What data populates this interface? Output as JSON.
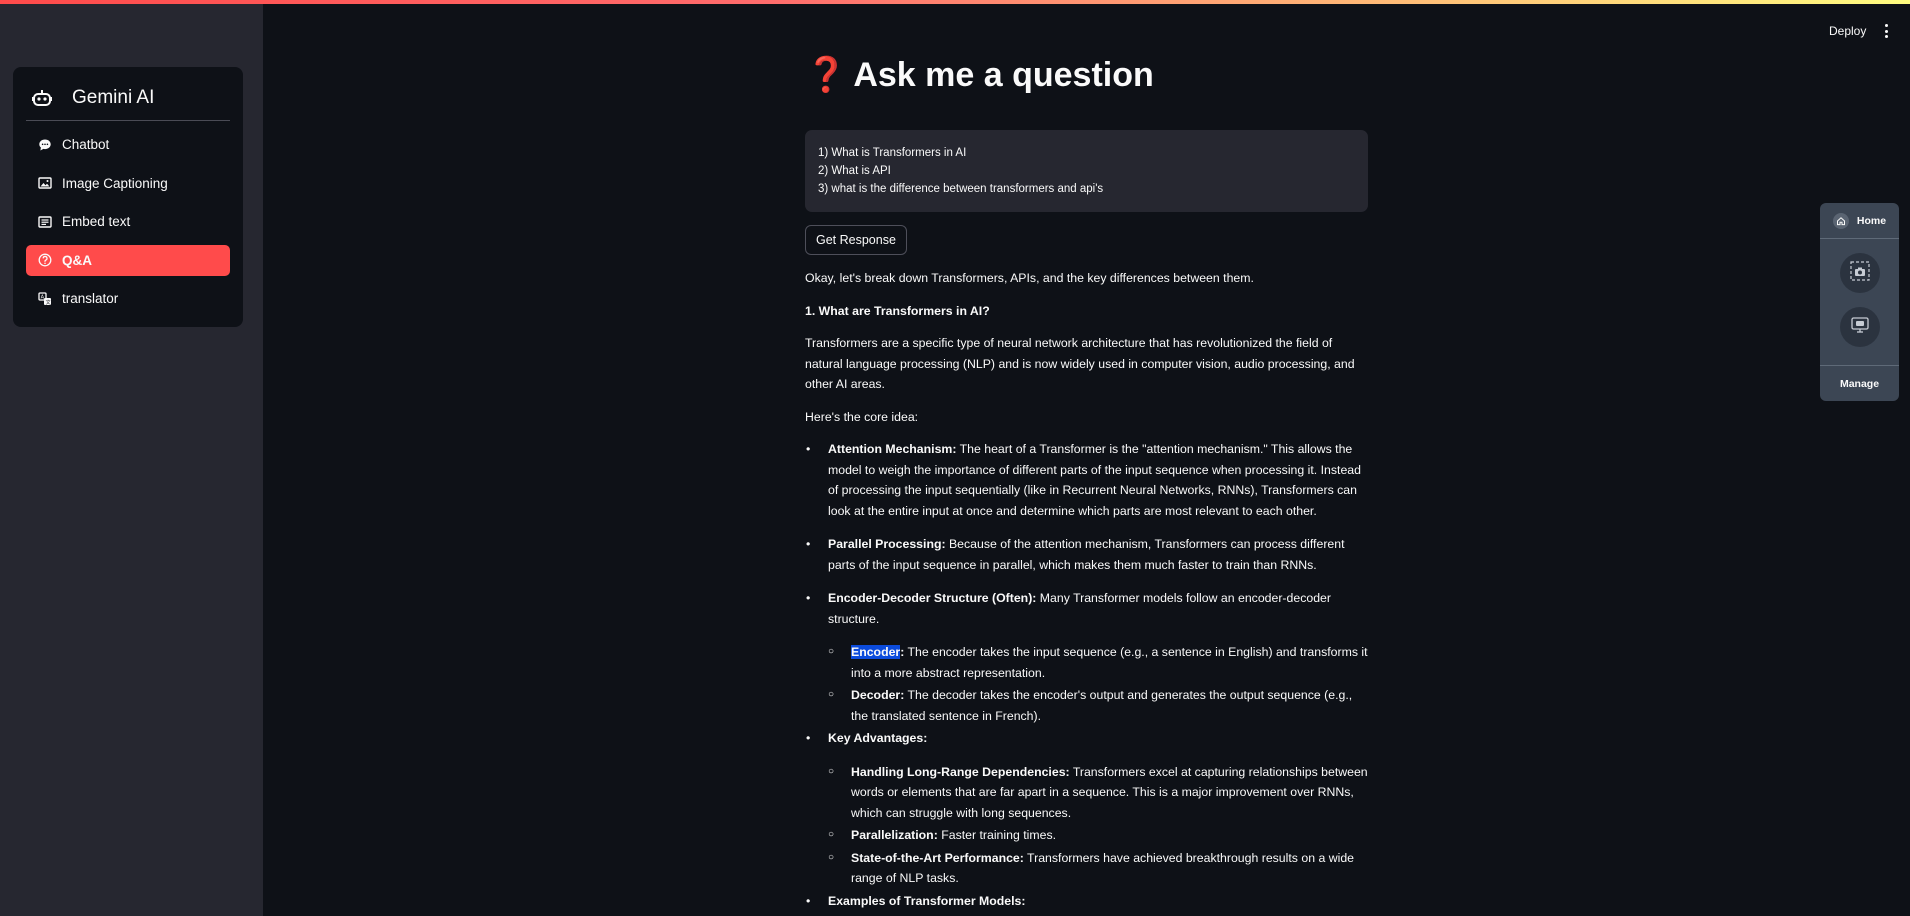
{
  "app": {
    "title": "Gemini AI"
  },
  "header": {
    "deploy_label": "Deploy"
  },
  "sidebar": {
    "items": [
      {
        "label": "Chatbot",
        "icon": "chat-bubble-icon",
        "active": false
      },
      {
        "label": "Image Captioning",
        "icon": "image-icon",
        "active": false
      },
      {
        "label": "Embed text",
        "icon": "text-card-icon",
        "active": false
      },
      {
        "label": "Q&A",
        "icon": "question-circle-icon",
        "active": true
      },
      {
        "label": "translator",
        "icon": "translate-icon",
        "active": false
      }
    ]
  },
  "main": {
    "title_icon": "❓",
    "title": "Ask me a question",
    "question_input": "1) What is Transformers in AI\n2) What is API\n3) what is the difference between transformers and api's",
    "get_response_label": "Get Response",
    "response": {
      "intro": "Okay, let's break down Transformers, APIs, and the key differences between them.",
      "section1_heading": "1. What are Transformers in AI?",
      "section1_para": "Transformers are a specific type of neural network architecture that has revolutionized the field of natural language processing (NLP) and is now widely used in computer vision, audio processing, and other AI areas.",
      "core_idea": "Here's the core idea:",
      "b1_term": "Attention Mechanism:",
      "b1_text": " The heart of a Transformer is the \"attention mechanism.\" This allows the model to weigh the importance of different parts of the input sequence when processing it. Instead of processing the input sequentially (like in Recurrent Neural Networks, RNNs), Transformers can look at the entire input at once and determine which parts are most relevant to each other.",
      "b2_term": "Parallel Processing:",
      "b2_text": " Because of the attention mechanism, Transformers can process different parts of the input sequence in parallel, which makes them much faster to train than RNNs.",
      "b3_term": "Encoder-Decoder Structure (Often):",
      "b3_text": " Many Transformer models follow an encoder-decoder structure.",
      "b3a_term": "Encoder",
      "b3a_colon": ":",
      "b3a_text": " The encoder takes the input sequence (e.g., a sentence in English) and transforms it into a more abstract representation.",
      "b3b_term": "Decoder:",
      "b3b_text": " The decoder takes the encoder's output and generates the output sequence (e.g., the translated sentence in French).",
      "b4_term": "Key Advantages:",
      "b4a_term": "Handling Long-Range Dependencies:",
      "b4a_text": " Transformers excel at capturing relationships between words or elements that are far apart in a sequence. This is a major improvement over RNNs, which can struggle with long sequences.",
      "b4b_term": "Parallelization:",
      "b4b_text": " Faster training times.",
      "b4c_term": "State-of-the-Art Performance:",
      "b4c_text": " Transformers have achieved breakthrough results on a wide range of NLP tasks.",
      "b5_term": "Examples of Transformer Models:"
    }
  },
  "floating_panel": {
    "home_label": "Home",
    "manage_label": "Manage",
    "buttons": [
      "screenshot-icon",
      "screen-record-icon"
    ]
  },
  "colors": {
    "accent": "#ff4b4b",
    "background": "#0e1117",
    "sidebar": "#262730",
    "highlight": "#0b4bdc"
  }
}
